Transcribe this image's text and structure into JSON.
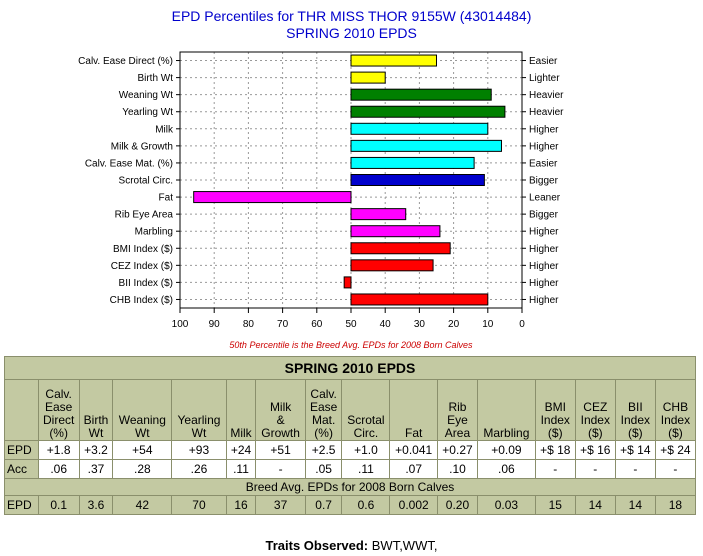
{
  "title_line1": "EPD Percentiles for THR MISS THOR 9155W (43014484)",
  "title_line2": "SPRING 2010 EPDS",
  "note": "50th Percentile is the Breed Avg. EPDs for 2008 Born Calves",
  "chart_data": {
    "type": "bar",
    "orientation": "horizontal",
    "xlim": [
      100,
      0
    ],
    "xticks": [
      "100",
      "90",
      "80",
      "70",
      "60",
      "50",
      "40",
      "30",
      "20",
      "10",
      "0"
    ],
    "baseline": 50,
    "grid": true,
    "categories": [
      "Calv. Ease Direct (%)",
      "Birth Wt",
      "Weaning Wt",
      "Yearling Wt",
      "Milk",
      "Milk & Growth",
      "Calv. Ease Mat. (%)",
      "Scrotal Circ.",
      "Fat",
      "Rib Eye Area",
      "Marbling",
      "BMI Index ($)",
      "CEZ Index ($)",
      "BII Index ($)",
      "CHB Index ($)"
    ],
    "right_labels": [
      "Easier",
      "Lighter",
      "Heavier",
      "Heavier",
      "Higher",
      "Higher",
      "Easier",
      "Bigger",
      "Leaner",
      "Bigger",
      "Higher",
      "Higher",
      "Higher",
      "Higher",
      "Higher"
    ],
    "values": [
      25,
      40,
      9,
      5,
      10,
      6,
      14,
      11,
      96,
      34,
      24,
      21,
      26,
      52,
      10
    ],
    "colors": [
      "#ffff00",
      "#ffff00",
      "#008000",
      "#008000",
      "#00ffff",
      "#00ffff",
      "#00ffff",
      "#0000cc",
      "#ff00ff",
      "#ff00ff",
      "#ff00ff",
      "#ff0000",
      "#ff0000",
      "#ff0000",
      "#ff0000"
    ]
  },
  "table": {
    "title": "SPRING 2010 EPDS",
    "headers": [
      [
        "Calv.",
        "Ease",
        "Direct",
        "(%)"
      ],
      [
        "Birth",
        "Wt"
      ],
      [
        "Weaning",
        "Wt"
      ],
      [
        "Yearling",
        "Wt"
      ],
      [
        "Milk"
      ],
      [
        "Milk",
        "&",
        "Growth"
      ],
      [
        "Calv.",
        "Ease",
        "Mat.",
        "(%)"
      ],
      [
        "Scrotal",
        "Circ."
      ],
      [
        "Fat"
      ],
      [
        "Rib",
        "Eye",
        "Area"
      ],
      [
        "Marbling"
      ],
      [
        "BMI",
        "Index",
        "($)"
      ],
      [
        "CEZ",
        "Index",
        "($)"
      ],
      [
        "BII",
        "Index",
        "($)"
      ],
      [
        "CHB",
        "Index",
        "($)"
      ]
    ],
    "epd_label": "EPD",
    "epd": [
      "+1.8",
      "+3.2",
      "+54",
      "+93",
      "+24",
      "+51",
      "+2.5",
      "+1.0",
      "+0.041",
      "+0.27",
      "+0.09",
      "+$ 18",
      "+$ 16",
      "+$ 14",
      "+$ 24"
    ],
    "acc_label": "Acc",
    "acc": [
      ".06",
      ".37",
      ".28",
      ".26",
      ".11",
      "-",
      ".05",
      ".11",
      ".07",
      ".10",
      ".06",
      "-",
      "-",
      "-",
      "-"
    ],
    "breed_title": "Breed Avg. EPDs for 2008 Born Calves",
    "avg_label": "EPD",
    "avg": [
      "0.1",
      "3.6",
      "42",
      "70",
      "16",
      "37",
      "0.7",
      "0.6",
      "0.002",
      "0.20",
      "0.03",
      "15",
      "14",
      "14",
      "18"
    ]
  },
  "traits_label": "Traits Observed:",
  "traits_value": "BWT,WWT,"
}
